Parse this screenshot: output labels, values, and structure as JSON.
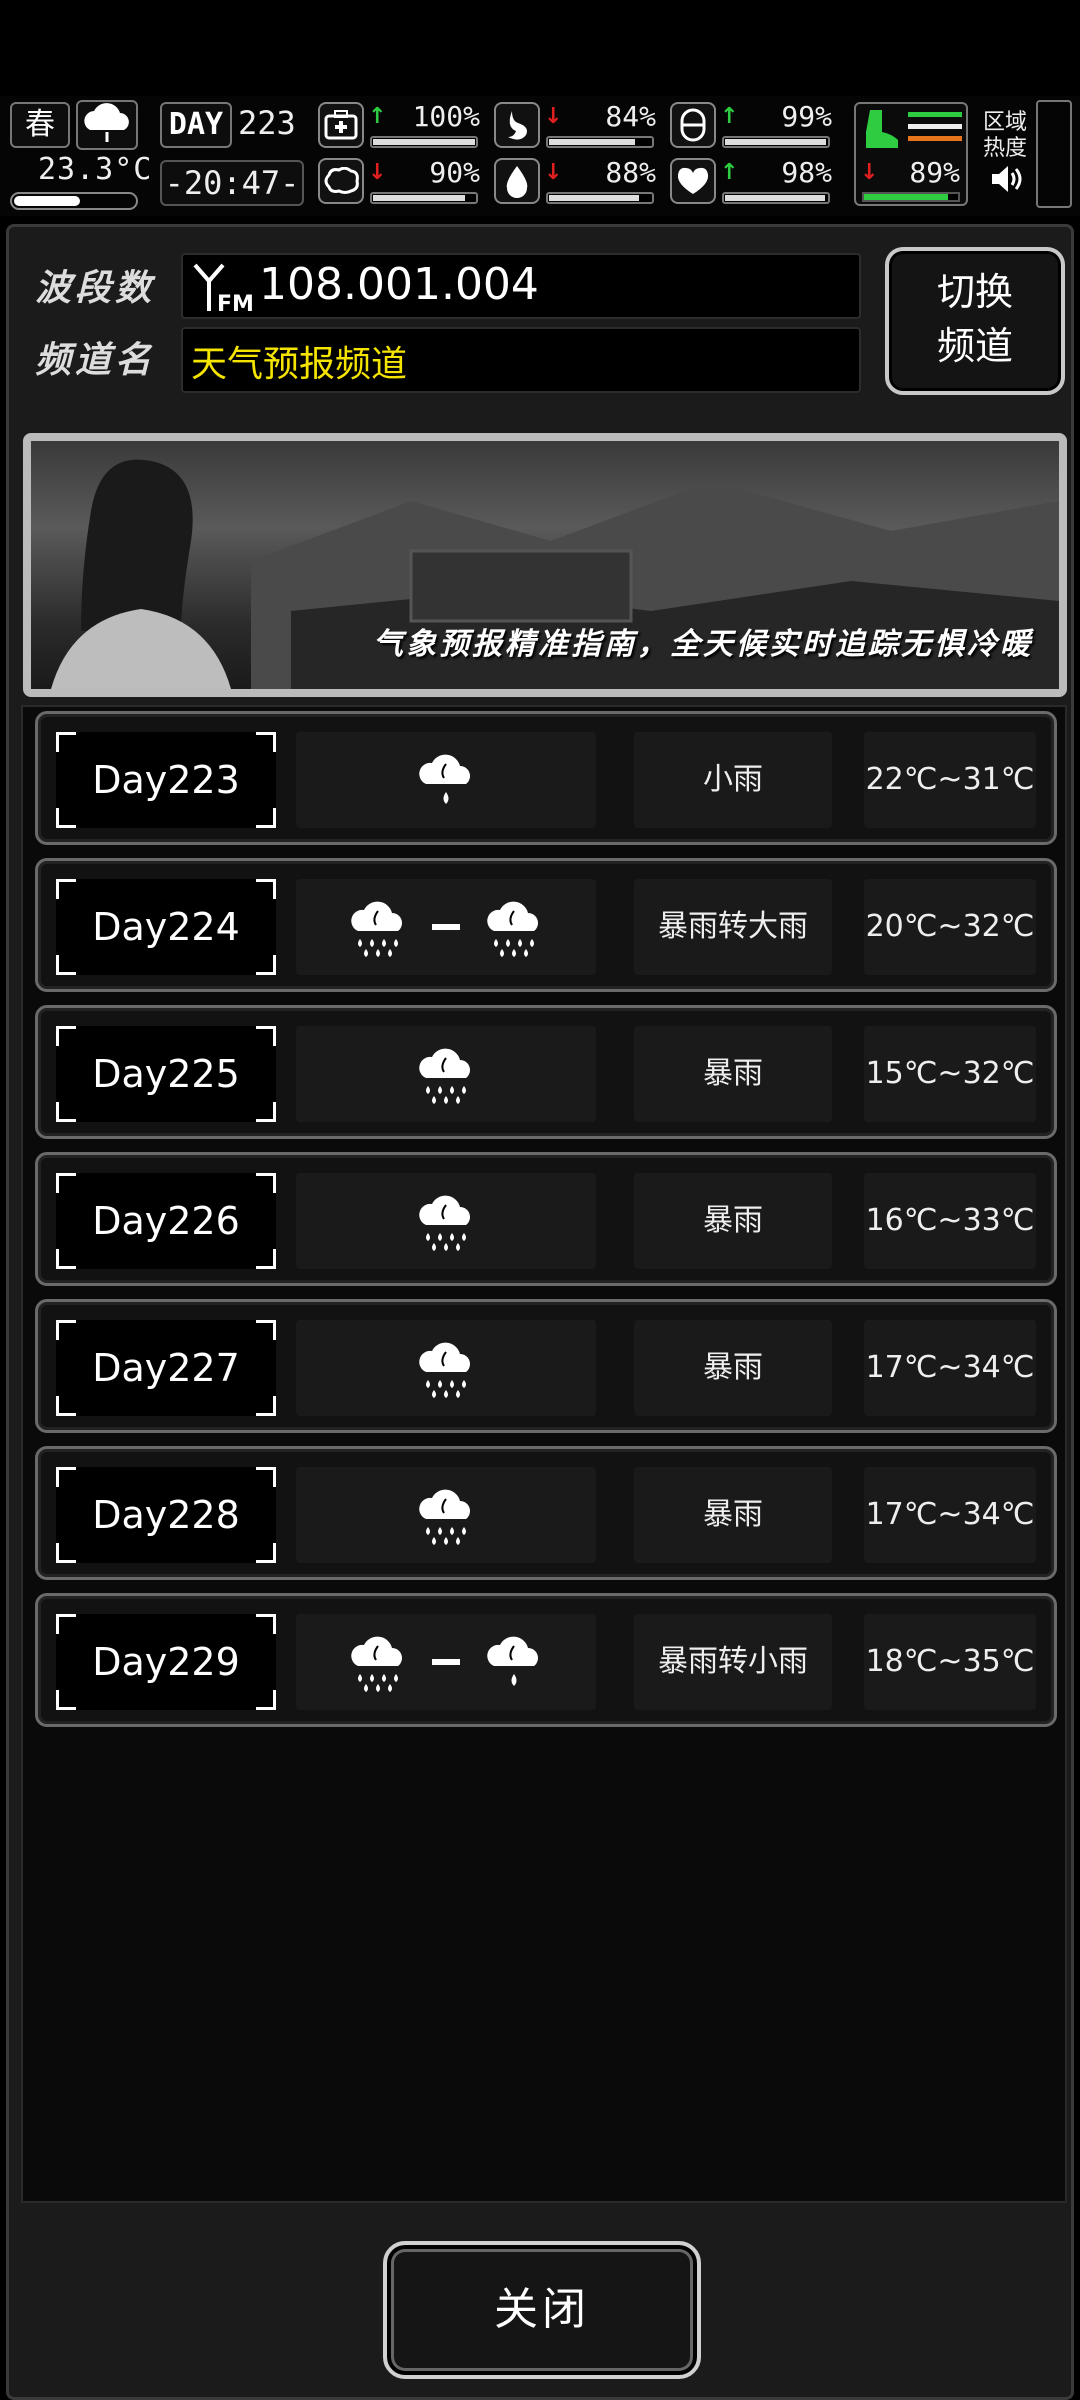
{
  "hud": {
    "season": "春",
    "temperature": "23.3°C",
    "thermometer_level": 0.55,
    "day_badge": "DAY",
    "day_number": "223",
    "clock": "-20:47-",
    "stats": [
      {
        "name": "health",
        "icon": "medkit-icon",
        "trend": "up",
        "percent": "100%",
        "value": 1.0
      },
      {
        "name": "hunger",
        "icon": "stomach-icon",
        "trend": "down",
        "percent": "84%",
        "value": 0.84
      },
      {
        "name": "mood",
        "icon": "capsule-icon",
        "trend": "up",
        "percent": "99%",
        "value": 0.99
      },
      {
        "name": "mind",
        "icon": "brain-icon",
        "trend": "down",
        "percent": "90%",
        "value": 0.9
      },
      {
        "name": "thirst",
        "icon": "water-drop-icon",
        "trend": "down",
        "percent": "88%",
        "value": 0.88
      },
      {
        "name": "heart",
        "icon": "heart-icon",
        "trend": "up",
        "percent": "98%",
        "value": 0.98
      }
    ],
    "stamina": {
      "trend": "down",
      "percent": "89%",
      "value": 0.89
    },
    "region_heat_label": "区域热度"
  },
  "radio": {
    "band_label": "波段数",
    "frequency": "108.001.004",
    "channel_label": "频道名",
    "channel_name": "天气预报频道",
    "switch_label": "切换频道"
  },
  "banner": {
    "text": "气象预报精准指南，全天候实时追踪无惧冷暖"
  },
  "forecast": [
    {
      "day": "Day223",
      "icons": [
        "light-rain"
      ],
      "desc": "小雨",
      "temp": "22℃~31℃"
    },
    {
      "day": "Day224",
      "icons": [
        "heavy-rain",
        "heavy-rain"
      ],
      "desc": "暴雨转大雨",
      "temp": "20℃~32℃"
    },
    {
      "day": "Day225",
      "icons": [
        "heavy-rain"
      ],
      "desc": "暴雨",
      "temp": "15℃~32℃"
    },
    {
      "day": "Day226",
      "icons": [
        "heavy-rain"
      ],
      "desc": "暴雨",
      "temp": "16℃~33℃"
    },
    {
      "day": "Day227",
      "icons": [
        "heavy-rain"
      ],
      "desc": "暴雨",
      "temp": "17℃~34℃"
    },
    {
      "day": "Day228",
      "icons": [
        "heavy-rain"
      ],
      "desc": "暴雨",
      "temp": "17℃~34℃"
    },
    {
      "day": "Day229",
      "icons": [
        "heavy-rain",
        "light-rain"
      ],
      "desc": "暴雨转小雨",
      "temp": "18℃~35℃"
    }
  ],
  "close_label": "关闭",
  "colors": {
    "up": "#2ecc40",
    "down": "#e02020",
    "channel": "#f5e400"
  }
}
